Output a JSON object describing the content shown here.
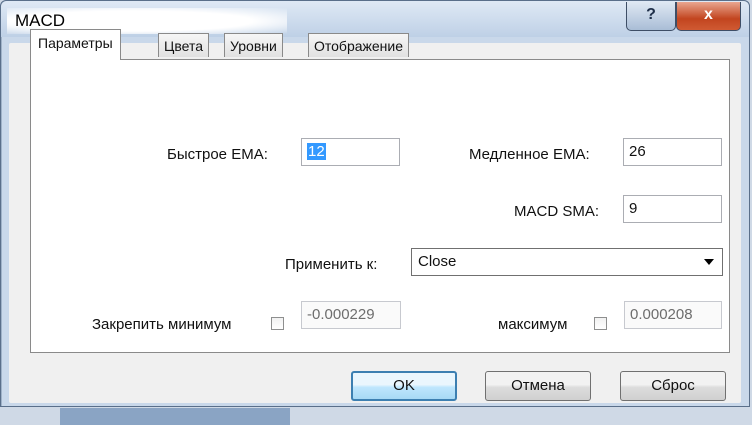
{
  "window": {
    "title": "MACD",
    "help_label": "?",
    "close_label": "x"
  },
  "tabs": [
    {
      "label": "Параметры",
      "active": true
    },
    {
      "label": "Цвета",
      "active": false
    },
    {
      "label": "Уровни",
      "active": false
    },
    {
      "label": "Отображение",
      "active": false
    }
  ],
  "params": {
    "fast_ema": {
      "label": "Быстрое EMA:",
      "value": "12"
    },
    "slow_ema": {
      "label": "Медленное EMA:",
      "value": "26"
    },
    "macd_sma": {
      "label": "MACD SMA:",
      "value": "9"
    },
    "apply_to": {
      "label": "Применить к:",
      "value": "Close"
    },
    "fix_min": {
      "label": "Закрепить минимум",
      "value": "-0.000229",
      "checked": false
    },
    "fix_max": {
      "label": "максимум",
      "value": "0.000208",
      "checked": false
    }
  },
  "buttons": {
    "ok": "OK",
    "cancel": "Отмена",
    "reset": "Сброс"
  },
  "colors": {
    "title_bar": "#c9d8ea",
    "close_button": "#c2451f",
    "default_button_border": "#3c7fb1",
    "selection": "#3399ff"
  }
}
